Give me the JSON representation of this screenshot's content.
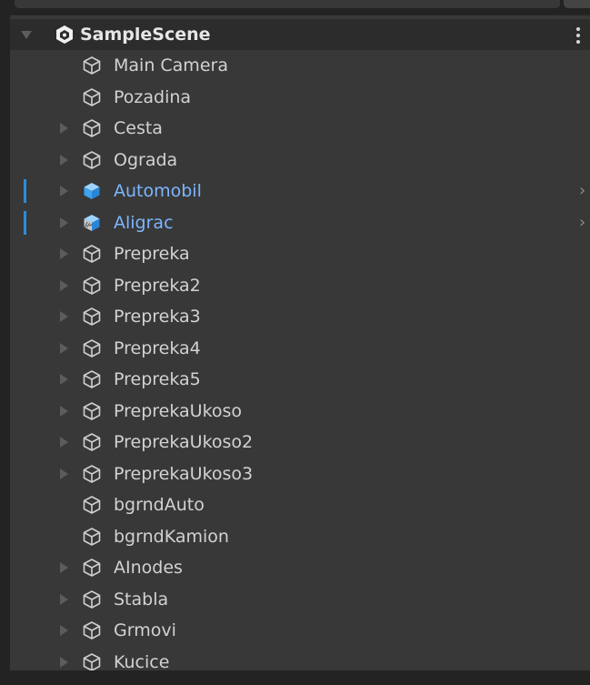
{
  "hierarchy": {
    "scene": {
      "label": "SampleScene",
      "icon": "unity-scene-icon",
      "menu_icon": "kebab-menu-icon"
    },
    "items": [
      {
        "label": "Main Camera",
        "icon": "gameobject-icon",
        "has_children": false,
        "prefab": false
      },
      {
        "label": "Pozadina",
        "icon": "gameobject-icon",
        "has_children": false,
        "prefab": false
      },
      {
        "label": "Cesta",
        "icon": "gameobject-icon",
        "has_children": true,
        "prefab": false
      },
      {
        "label": "Ograda",
        "icon": "gameobject-icon",
        "has_children": true,
        "prefab": false
      },
      {
        "label": "Automobil",
        "icon": "prefab-icon",
        "has_children": true,
        "prefab": true,
        "overridden": true
      },
      {
        "label": "Aligrac",
        "icon": "prefab-variant-icon",
        "has_children": true,
        "prefab": true,
        "overridden": true
      },
      {
        "label": "Prepreka",
        "icon": "gameobject-icon",
        "has_children": true,
        "prefab": false
      },
      {
        "label": "Prepreka2",
        "icon": "gameobject-icon",
        "has_children": true,
        "prefab": false
      },
      {
        "label": "Prepreka3",
        "icon": "gameobject-icon",
        "has_children": true,
        "prefab": false
      },
      {
        "label": "Prepreka4",
        "icon": "gameobject-icon",
        "has_children": true,
        "prefab": false
      },
      {
        "label": "Prepreka5",
        "icon": "gameobject-icon",
        "has_children": true,
        "prefab": false
      },
      {
        "label": "PreprekaUkoso",
        "icon": "gameobject-icon",
        "has_children": true,
        "prefab": false
      },
      {
        "label": "PreprekaUkoso2",
        "icon": "gameobject-icon",
        "has_children": true,
        "prefab": false
      },
      {
        "label": "PreprekaUkoso3",
        "icon": "gameobject-icon",
        "has_children": true,
        "prefab": false
      },
      {
        "label": "bgrndAuto",
        "icon": "gameobject-icon",
        "has_children": false,
        "prefab": false
      },
      {
        "label": "bgrndKamion",
        "icon": "gameobject-icon",
        "has_children": false,
        "prefab": false
      },
      {
        "label": "AInodes",
        "icon": "gameobject-icon",
        "has_children": true,
        "prefab": false
      },
      {
        "label": "Stabla",
        "icon": "gameobject-icon",
        "has_children": true,
        "prefab": false
      },
      {
        "label": "Grmovi",
        "icon": "gameobject-icon",
        "has_children": true,
        "prefab": false
      },
      {
        "label": "Kucice",
        "icon": "gameobject-icon",
        "has_children": true,
        "prefab": false
      }
    ]
  },
  "colors": {
    "background": "#383838",
    "text": "#d2d2d2",
    "prefab_text": "#7cb6ff",
    "override_bar": "#2c8cd8"
  }
}
